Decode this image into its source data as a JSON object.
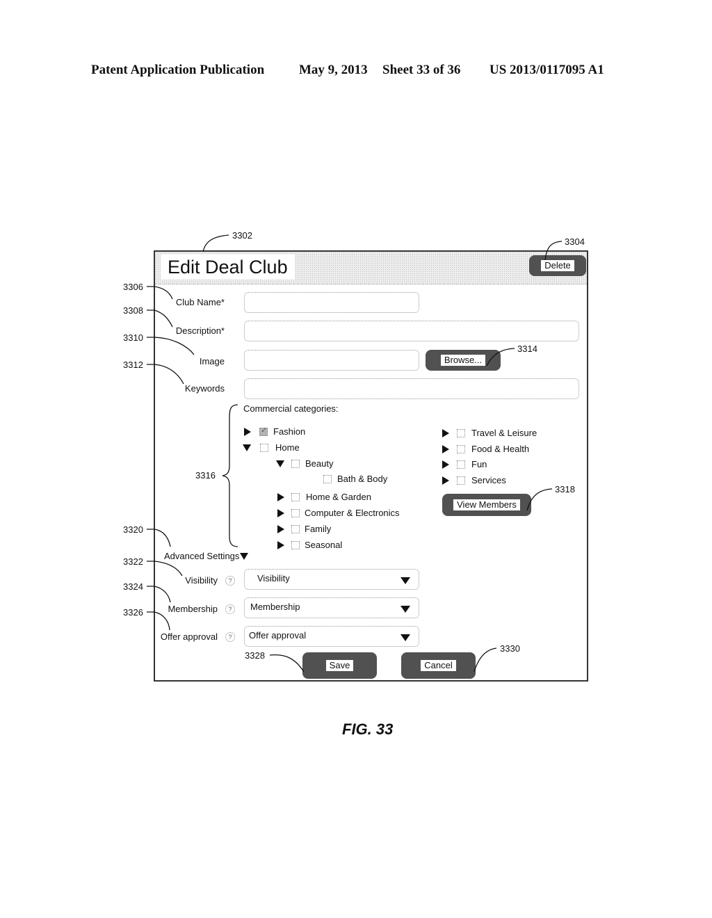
{
  "header": {
    "publication": "Patent Application Publication",
    "date": "May 9, 2013",
    "sheet": "Sheet 33 of 36",
    "number": "US 2013/0117095 A1"
  },
  "dialog": {
    "title": "Edit Deal Club",
    "delete_label": "Delete",
    "fields": {
      "club_name_label": "Club Name*",
      "club_name_value": "",
      "description_label": "Description*",
      "description_value": "",
      "image_label": "Image",
      "image_value": "",
      "browse_label": "Browse...",
      "keywords_label": "Keywords",
      "keywords_value": ""
    },
    "categories": {
      "heading": "Commercial categories:",
      "left": [
        {
          "label": "Fashion",
          "expander": "collapsed",
          "checked": true,
          "level": 0
        },
        {
          "label": "Home",
          "expander": "expanded",
          "checked": false,
          "level": 0
        },
        {
          "label": "Beauty",
          "expander": "expanded",
          "checked": false,
          "level": 1
        },
        {
          "label": "Bath & Body",
          "expander": "none",
          "checked": false,
          "level": 2
        },
        {
          "label": "Home & Garden",
          "expander": "collapsed",
          "checked": false,
          "level": 1
        },
        {
          "label": "Computer & Electronics",
          "expander": "collapsed",
          "checked": false,
          "level": 1
        },
        {
          "label": "Family",
          "expander": "collapsed",
          "checked": false,
          "level": 1
        },
        {
          "label": "Seasonal",
          "expander": "collapsed",
          "checked": false,
          "level": 1
        }
      ],
      "right": [
        {
          "label": "Travel & Leisure",
          "expander": "collapsed",
          "checked": false
        },
        {
          "label": "Food & Health",
          "expander": "collapsed",
          "checked": false
        },
        {
          "label": "Fun",
          "expander": "collapsed",
          "checked": false
        },
        {
          "label": "Services",
          "expander": "collapsed",
          "checked": false
        }
      ],
      "view_members_label": "View Members"
    },
    "advanced": {
      "label": "Advanced Settings",
      "visibility_label": "Visibility",
      "visibility_value": "Visibility",
      "membership_label": "Membership",
      "membership_value": "Membership",
      "offer_approval_label": "Offer approval",
      "offer_approval_value": "Offer approval",
      "help_glyph": "?"
    },
    "save_label": "Save",
    "cancel_label": "Cancel"
  },
  "references": {
    "r3302": "3302",
    "r3304": "3304",
    "r3306": "3306",
    "r3308": "3308",
    "r3310": "3310",
    "r3312": "3312",
    "r3314": "3314",
    "r3316": "3316",
    "r3318": "3318",
    "r3320": "3320",
    "r3322": "3322",
    "r3324": "3324",
    "r3326": "3326",
    "r3328": "3328",
    "r3330": "3330"
  },
  "figure_caption": "FIG. 33"
}
